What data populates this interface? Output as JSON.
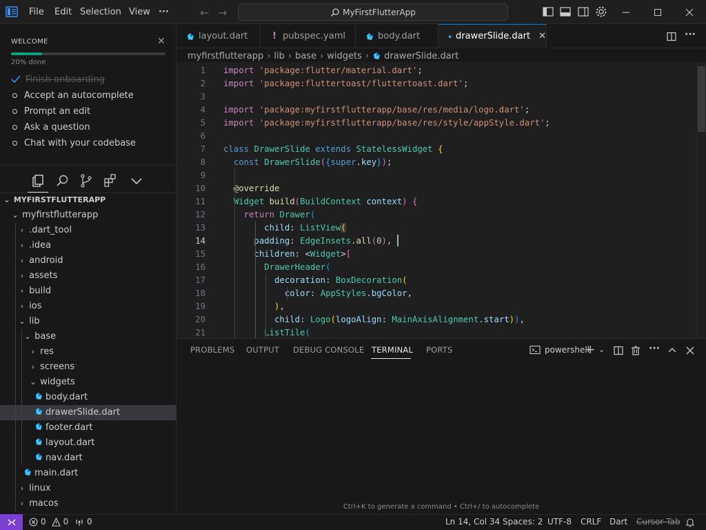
{
  "menu": {
    "file": "File",
    "edit": "Edit",
    "selection": "Selection",
    "view": "View",
    "more": "···"
  },
  "command_center": {
    "label": "MyFirstFlutterApp"
  },
  "welcome": {
    "title": "WELCOME",
    "progress_text": "20% done",
    "progress": 0.2,
    "items": [
      {
        "label": "Finish onboarding",
        "done": true
      },
      {
        "label": "Accept an autocomplete",
        "done": false
      },
      {
        "label": "Prompt an edit",
        "done": false
      },
      {
        "label": "Ask a question",
        "done": false
      },
      {
        "label": "Chat with your codebase",
        "done": false
      }
    ]
  },
  "explorer": {
    "root": "MYFIRSTFLUTTERAPP",
    "items": [
      {
        "label": "myfirstflutterapp",
        "kind": "folder-open"
      },
      {
        "label": ".dart_tool",
        "kind": "folder"
      },
      {
        "label": ".idea",
        "kind": "folder"
      },
      {
        "label": "android",
        "kind": "folder"
      },
      {
        "label": "assets",
        "kind": "folder"
      },
      {
        "label": "build",
        "kind": "folder"
      },
      {
        "label": "ios",
        "kind": "folder"
      },
      {
        "label": "lib",
        "kind": "folder-open"
      },
      {
        "label": "base",
        "kind": "folder-open"
      },
      {
        "label": "res",
        "kind": "folder"
      },
      {
        "label": "screens",
        "kind": "folder"
      },
      {
        "label": "widgets",
        "kind": "folder-open"
      },
      {
        "label": "body.dart",
        "kind": "dart"
      },
      {
        "label": "drawerSlide.dart",
        "kind": "dart"
      },
      {
        "label": "footer.dart",
        "kind": "dart"
      },
      {
        "label": "layout.dart",
        "kind": "dart"
      },
      {
        "label": "nav.dart",
        "kind": "dart"
      },
      {
        "label": "main.dart",
        "kind": "dart"
      },
      {
        "label": "linux",
        "kind": "folder"
      },
      {
        "label": "macos",
        "kind": "folder"
      }
    ]
  },
  "tabs": [
    {
      "label": "layout.dart",
      "icon": "dart-icon"
    },
    {
      "label": "pubspec.yaml",
      "icon": "yaml-icon"
    },
    {
      "label": "body.dart",
      "icon": "dart-icon"
    },
    {
      "label": "drawerSlide.dart",
      "icon": "dart-icon",
      "active": true
    }
  ],
  "breadcrumb": [
    "myfirstflutterapp",
    "lib",
    "base",
    "widgets",
    "drawerSlide.dart"
  ],
  "editor": {
    "line_numbers": [
      "1",
      "2",
      "3",
      "4",
      "5",
      "6",
      "7",
      "8",
      "9",
      "10",
      "11",
      "12",
      "13",
      "14",
      "15",
      "16",
      "17",
      "18",
      "19",
      "20",
      "21"
    ],
    "current_line": "14"
  },
  "panel": {
    "tabs": [
      "PROBLEMS",
      "OUTPUT",
      "DEBUG CONSOLE",
      "TERMINAL",
      "PORTS"
    ],
    "active_tab": "TERMINAL",
    "shell": "powershell",
    "hint": "Ctrl+K to generate a command • Ctrl+/ to autocomplete"
  },
  "status": {
    "errors": "0",
    "warnings": "0",
    "ports": "0",
    "position": "Ln 14, Col 34",
    "spaces": "Spaces: 2",
    "encoding": "UTF-8",
    "eol": "CRLF",
    "language": "Dart",
    "cursor_tab": "Cursor Tab"
  },
  "colors": {
    "accent": "#0078d4",
    "progress": "#0fa07f",
    "remote": "#7b3fd6"
  }
}
